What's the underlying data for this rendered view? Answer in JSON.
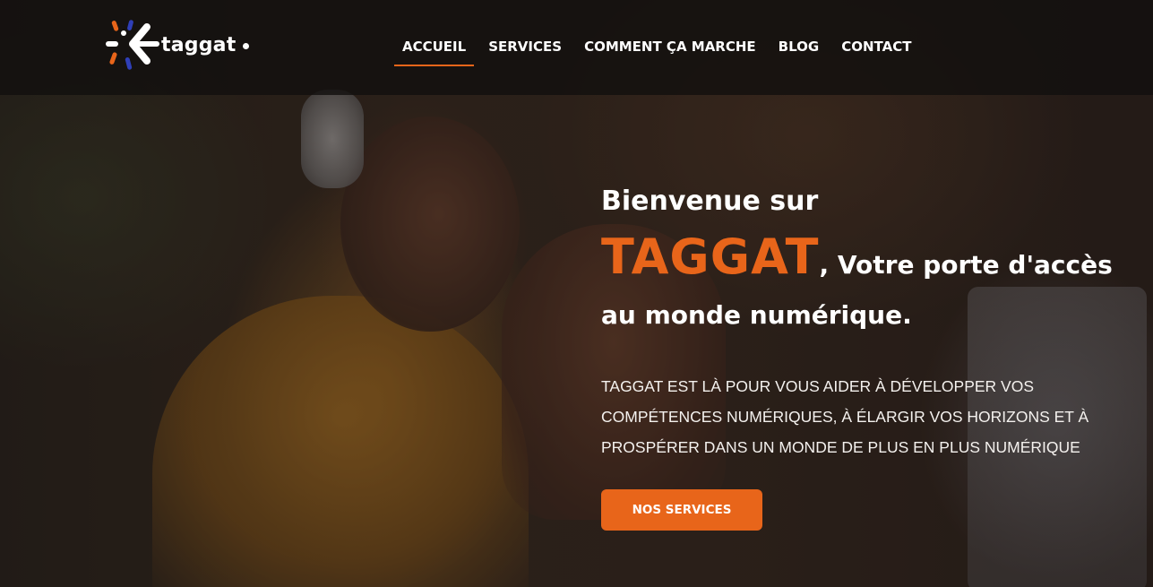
{
  "header": {
    "logo_text": "taggat",
    "nav": [
      {
        "label": "ACCUEIL",
        "active": true
      },
      {
        "label": "SERVICES",
        "active": false
      },
      {
        "label": "COMMENT ÇA MARCHE",
        "active": false
      },
      {
        "label": "BLOG",
        "active": false
      },
      {
        "label": "CONTACT",
        "active": false
      }
    ]
  },
  "hero": {
    "welcome": "Bienvenue sur",
    "brand": "TAGGAT",
    "tagline_part1": ", Votre porte d'accès",
    "tagline_part2": "au monde numérique.",
    "description": "TAGGAT EST LÀ POUR VOUS AIDER À DÉVELOPPER VOS COMPÉTENCES NUMÉRIQUES, À ÉLARGIR VOS HORIZONS ET À PROSPÉRER DANS UN MONDE DE PLUS EN PLUS NUMÉRIQUE",
    "cta_label": "NOS SERVICES"
  },
  "colors": {
    "accent": "#e8651a",
    "header_bg": "#12100f",
    "text": "#ffffff",
    "logo_blue": "#2f3fb8"
  },
  "icons": {
    "logo": "taggat-logo-mark"
  }
}
